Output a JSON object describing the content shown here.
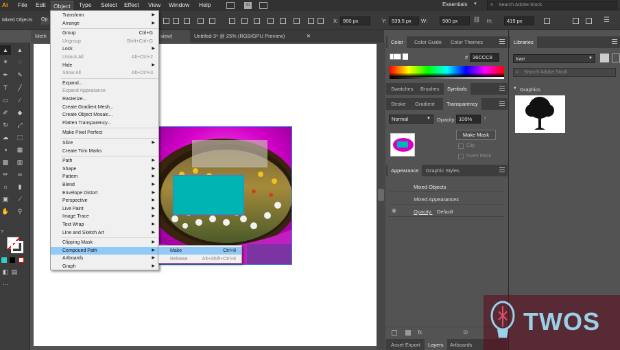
{
  "menubar": {
    "logo": "Ai",
    "items": [
      "File",
      "Edit",
      "Object",
      "Type",
      "Select",
      "Effect",
      "View",
      "Window",
      "Help"
    ],
    "workspace": "Essentials",
    "search_placeholder": "Search Adobe Stock"
  },
  "controlbar": {
    "selection_label": "Mixed Objects",
    "x_label": "X:",
    "x_value": "960 px",
    "y_label": "Y:",
    "y_value": "539,5 px",
    "w_label": "W:",
    "w_value": "500 px",
    "h_label": "H:",
    "h_value": "419 px"
  },
  "doc_tabs": [
    {
      "label": "Meth"
    },
    {
      "label": "view)"
    },
    {
      "label": "Untitled-3* @ 25% (RGB/GPU Preview)"
    }
  ],
  "object_menu": {
    "items": [
      {
        "label": "Transform",
        "shortcut": "",
        "submenu": true,
        "disabled": false
      },
      {
        "label": "Arrange",
        "shortcut": "",
        "submenu": true,
        "disabled": false
      },
      {
        "sep": true
      },
      {
        "label": "Group",
        "shortcut": "Ctrl+G",
        "submenu": false,
        "disabled": false
      },
      {
        "label": "Ungroup",
        "shortcut": "Shift+Ctrl+G",
        "submenu": false,
        "disabled": true
      },
      {
        "label": "Lock",
        "shortcut": "",
        "submenu": true,
        "disabled": false
      },
      {
        "label": "Unlock All",
        "shortcut": "Alt+Ctrl+2",
        "submenu": false,
        "disabled": true
      },
      {
        "label": "Hide",
        "shortcut": "",
        "submenu": true,
        "disabled": false
      },
      {
        "label": "Show All",
        "shortcut": "Alt+Ctrl+3",
        "submenu": false,
        "disabled": true
      },
      {
        "sep": true
      },
      {
        "label": "Expand...",
        "shortcut": "",
        "submenu": false,
        "disabled": false
      },
      {
        "label": "Expand Appearance",
        "shortcut": "",
        "submenu": false,
        "disabled": true
      },
      {
        "label": "Rasterize...",
        "shortcut": "",
        "submenu": false,
        "disabled": false
      },
      {
        "label": "Create Gradient Mesh...",
        "shortcut": "",
        "submenu": false,
        "disabled": false
      },
      {
        "label": "Create Object Mosaic...",
        "shortcut": "",
        "submenu": false,
        "disabled": false
      },
      {
        "label": "Flatten Transparency...",
        "shortcut": "",
        "submenu": false,
        "disabled": false
      },
      {
        "sep": true
      },
      {
        "label": "Make Pixel Perfect",
        "shortcut": "",
        "submenu": false,
        "disabled": false
      },
      {
        "sep": true
      },
      {
        "label": "Slice",
        "shortcut": "",
        "submenu": true,
        "disabled": false
      },
      {
        "label": "Create Trim Marks",
        "shortcut": "",
        "submenu": false,
        "disabled": false
      },
      {
        "sep": true
      },
      {
        "label": "Path",
        "shortcut": "",
        "submenu": true,
        "disabled": false
      },
      {
        "label": "Shape",
        "shortcut": "",
        "submenu": true,
        "disabled": false
      },
      {
        "label": "Pattern",
        "shortcut": "",
        "submenu": true,
        "disabled": false
      },
      {
        "label": "Blend",
        "shortcut": "",
        "submenu": true,
        "disabled": false
      },
      {
        "label": "Envelope Distort",
        "shortcut": "",
        "submenu": true,
        "disabled": false
      },
      {
        "label": "Perspective",
        "shortcut": "",
        "submenu": true,
        "disabled": false
      },
      {
        "label": "Live Paint",
        "shortcut": "",
        "submenu": true,
        "disabled": false
      },
      {
        "label": "Image Trace",
        "shortcut": "",
        "submenu": true,
        "disabled": false
      },
      {
        "label": "Text Wrap",
        "shortcut": "",
        "submenu": true,
        "disabled": false
      },
      {
        "label": "Line and Sketch Art",
        "shortcut": "",
        "submenu": true,
        "disabled": false
      },
      {
        "sep": true
      },
      {
        "label": "Clipping Mask",
        "shortcut": "",
        "submenu": true,
        "disabled": false
      },
      {
        "label": "Compound Path",
        "shortcut": "",
        "submenu": true,
        "disabled": false,
        "highlight": true
      },
      {
        "label": "Artboards",
        "shortcut": "",
        "submenu": true,
        "disabled": false
      },
      {
        "label": "Graph",
        "shortcut": "",
        "submenu": true,
        "disabled": false
      }
    ]
  },
  "compound_submenu": {
    "make_label": "Make",
    "make_shortcut": "Ctrl+8",
    "release_label": "Release",
    "release_shortcut": "Alt+Shift+Ctrl+8"
  },
  "color_panel": {
    "tabs": [
      "Color",
      "Color Guide",
      "Color Themes"
    ],
    "hex_prefix": "#",
    "hex_value": "36CCC8"
  },
  "swatches_panel": {
    "tabs": [
      "Swatches",
      "Brushes",
      "Symbols"
    ]
  },
  "transparency_panel": {
    "tabs": [
      "Stroke",
      "Gradient",
      "Transparency"
    ],
    "blend_mode": "Normal",
    "opacity_label": "Opacity:",
    "opacity_value": "100%",
    "make_mask_label": "Make Mask",
    "clip_label": "Clip",
    "invert_label": "Invert Mask"
  },
  "appearance_panel": {
    "tabs": [
      "Appearance",
      "Graphic Styles"
    ],
    "title": "Mixed Objects",
    "sub": "Mixed Appearances",
    "opacity_label": "Opacity:",
    "opacity_value": "Default",
    "fx_label": "fx."
  },
  "bottom_tabs": [
    "Asset Export",
    "Layers",
    "Artboards"
  ],
  "libraries_panel": {
    "tab": "Libraries",
    "library_name": "trarr",
    "search_placeholder": "Search Adobe Stock",
    "section_label": "Graphics"
  },
  "watermark": {
    "text": "TWOS"
  },
  "colors": {
    "accent_fill": "#00b4b4",
    "highlight": "#91c9f7",
    "photo_bg": "#d400c8"
  }
}
